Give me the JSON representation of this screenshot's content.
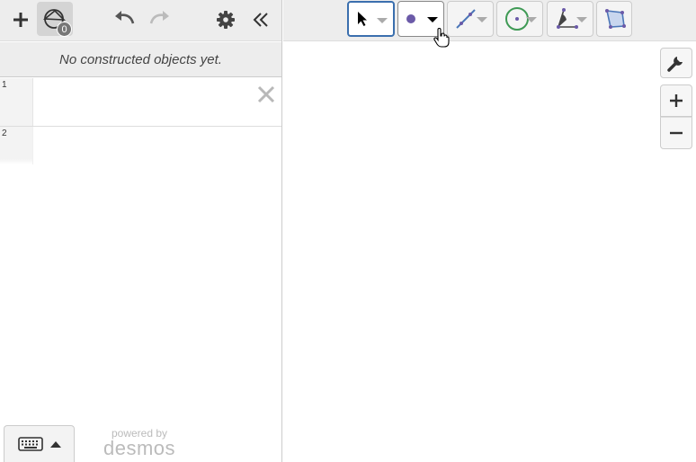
{
  "left_toolbar": {
    "construct_count": "0"
  },
  "empty_message": "No constructed objects yet.",
  "expressions": [
    {
      "number": "1"
    },
    {
      "number": "2"
    }
  ],
  "footer": {
    "powered_by": "powered by",
    "brand": "desmos"
  },
  "tools": [
    {
      "name": "select",
      "state": "selected"
    },
    {
      "name": "point",
      "state": "active"
    },
    {
      "name": "line"
    },
    {
      "name": "circle"
    },
    {
      "name": "angle"
    },
    {
      "name": "polygon"
    }
  ],
  "colors": {
    "point_purple": "#6b5aa8",
    "line_blue": "#4a76b8",
    "circle_green": "#3f9a55",
    "selected_border": "#3b6fae"
  }
}
